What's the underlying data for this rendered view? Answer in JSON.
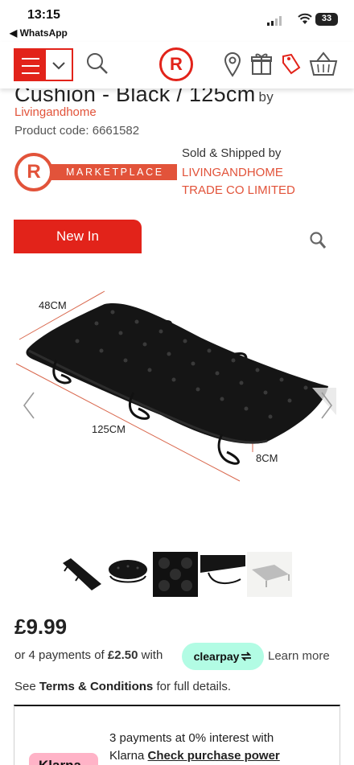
{
  "status_bar": {
    "time": "13:15",
    "back_app": "◀ WhatsApp",
    "battery": "33"
  },
  "header": {
    "logo_letter": "R"
  },
  "product": {
    "title_cut": "Cushion - Black / 125cm",
    "title_by": "by",
    "seller_link": "Livingandhome",
    "product_code": "Product code: 6661582",
    "marketplace_letter": "R",
    "marketplace_label": "MARKETPLACE",
    "sold_by_label": "Sold & Shipped by",
    "trader_line1": "LIVINGANDHOME",
    "trader_line2": "TRADE CO LIMITED",
    "badge": "New In"
  },
  "image": {
    "dim_width": "48CM",
    "dim_length": "125CM",
    "dim_height": "8CM"
  },
  "pricing": {
    "price": "£9.99",
    "installments_prefix": "or 4 payments of",
    "installment_amount": "£2.50",
    "installments_suffix": "with",
    "clearpay_label": "clearpay",
    "learn_more": "Learn more",
    "terms_prefix": "See",
    "terms_link": "Terms & Conditions",
    "terms_suffix": "for full details."
  },
  "klarna": {
    "badge": "Klarna",
    "line1": "3 payments at 0% interest with",
    "line2_prefix": "Klarna",
    "line2_link": "Check purchase power"
  },
  "colors": {
    "brand_red": "#e2231a",
    "marketplace_orange": "#e2533a",
    "clearpay_mint": "#b2fce4",
    "klarna_pink": "#ffb3c7"
  }
}
